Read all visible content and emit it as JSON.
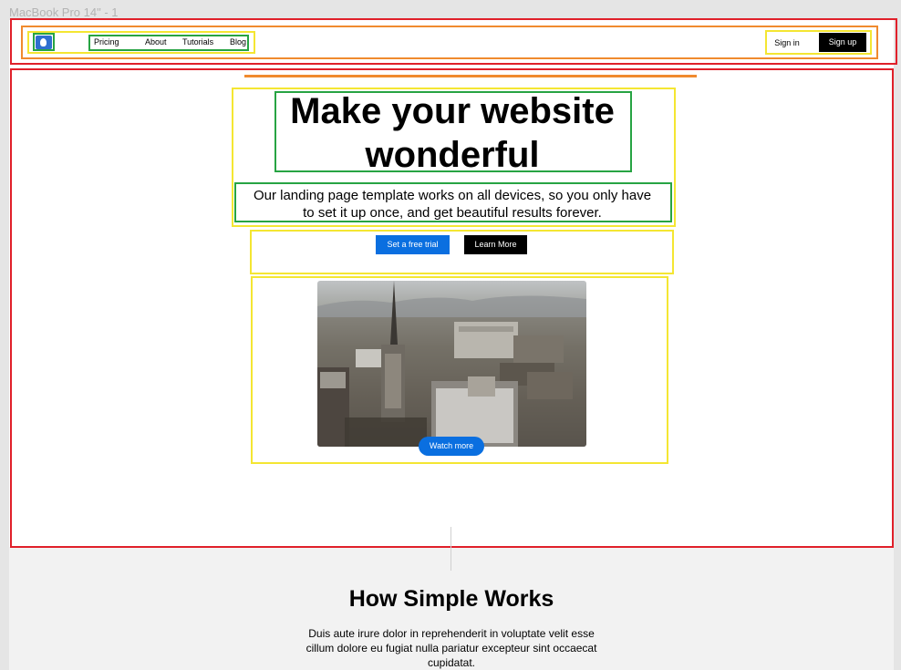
{
  "frame_label": "MacBook Pro 14\" - 1",
  "header": {
    "logo_icon": "logo-icon",
    "nav": [
      "Pricing",
      "About",
      "Tutorials",
      "Blog"
    ],
    "sign_in": "Sign in",
    "sign_up": "Sign up"
  },
  "hero": {
    "title": "Make your website\nwonderful",
    "subtitle": "Our landing page template works on all devices, so you only have\nto set it up once, and get beautiful results forever.",
    "primary_button": "Set a free trial",
    "secondary_button": "Learn More",
    "video_button": "Watch more"
  },
  "section": {
    "title": "How Simple Works",
    "text": "Duis aute irure dolor in reprehenderit in voluptate velit esse\ncillum dolore eu fugiat nulla pariatur excepteur sint occaecat\ncupidatat."
  },
  "colors": {
    "annotation_red": "#e0202a",
    "annotation_orange": "#f08a2e",
    "annotation_yellow": "#f4e632",
    "annotation_green": "#27a443",
    "primary_blue": "#0a6fe0",
    "black": "#000000"
  }
}
